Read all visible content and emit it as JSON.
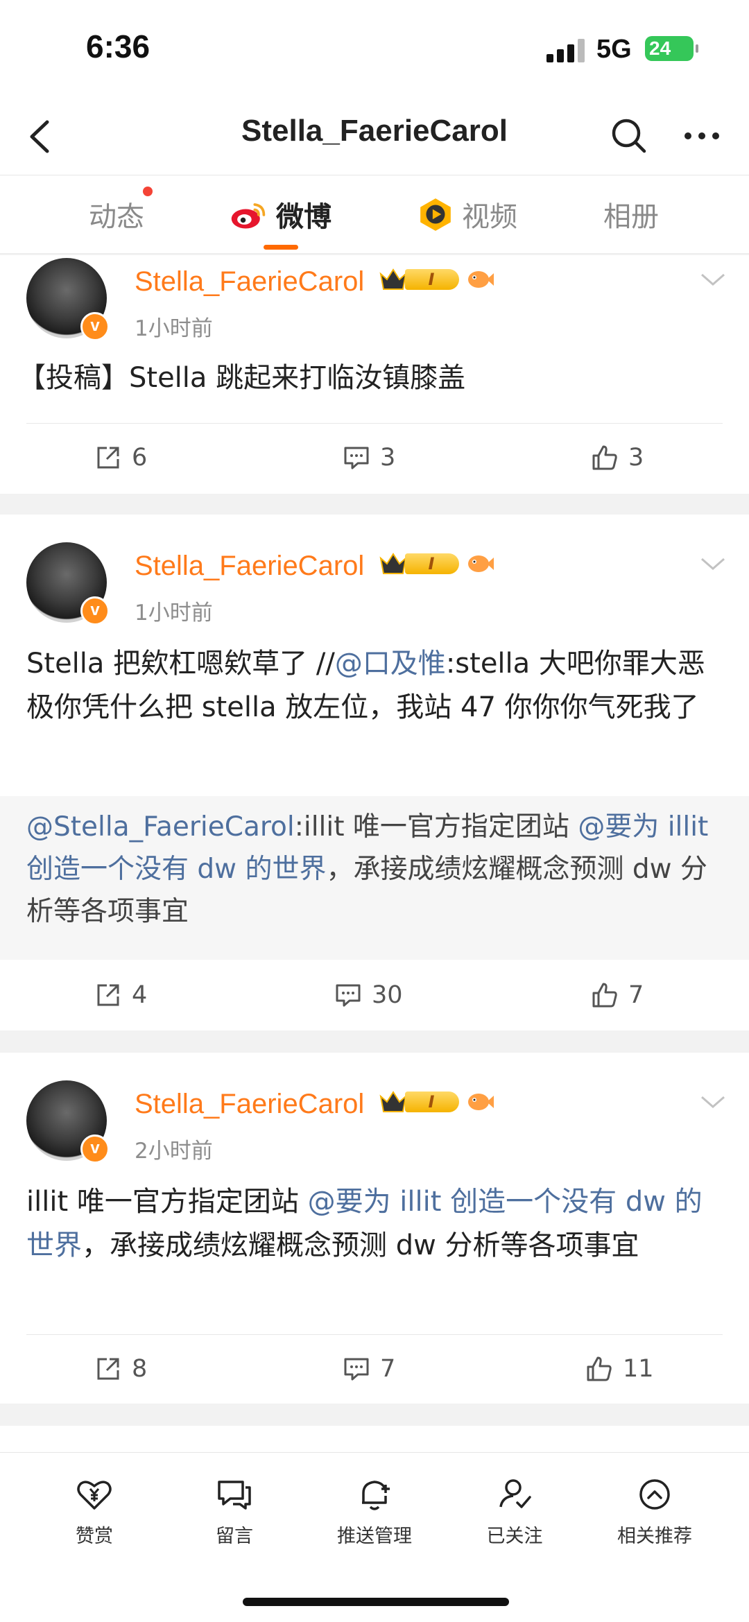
{
  "status_bar": {
    "time": "6:36",
    "network": "5G",
    "battery": "24"
  },
  "header": {
    "title": "Stella_FaerieCarol"
  },
  "tabs": [
    {
      "label": "动态",
      "has_dot": true
    },
    {
      "label": "微博",
      "active": true
    },
    {
      "label": "视频"
    },
    {
      "label": "相册"
    }
  ],
  "posts": [
    {
      "author": "Stella_FaerieCarol",
      "level": "I",
      "time": "1小时前",
      "text": "【投稿】Stella 跳起来打临汝镇膝盖",
      "repost_count": "6",
      "comment_count": "3",
      "like_count": "3"
    },
    {
      "author": "Stella_FaerieCarol",
      "level": "I",
      "time": "1小时前",
      "text_before": "Stella 把欸杠嗯欸草了 //",
      "mention": "@口及惟",
      "text_after": ":stella 大吧你罪大恶极你凭什么把 stella 放左位，我站 47 你你你气死我了",
      "repost_mention1": "@Stella_FaerieCarol",
      "repost_mid": ":illit 唯一官方指定团站 ",
      "repost_mention2": "@要为 illit 创造一个没有 dw 的世界",
      "repost_tail": "，承接成绩炫耀概念预测 dw 分析等各项事宜",
      "repost_count": "4",
      "comment_count": "30",
      "like_count": "7"
    },
    {
      "author": "Stella_FaerieCarol",
      "level": "I",
      "time": "2小时前",
      "text_before": "illit 唯一官方指定团站 ",
      "mention": "@要为 illit 创造一个没有 dw 的世界",
      "text_after": "，承接成绩炫耀概念预测 dw 分析等各项事宜",
      "repost_count": "8",
      "comment_count": "7",
      "like_count": "11"
    }
  ],
  "bottom_bar": [
    {
      "label": "赞赏",
      "icon": "heart-yen-icon"
    },
    {
      "label": "留言",
      "icon": "message-icon"
    },
    {
      "label": "推送管理",
      "icon": "bell-plus-icon"
    },
    {
      "label": "已关注",
      "icon": "user-check-icon"
    },
    {
      "label": "相关推荐",
      "icon": "chevron-up-circle-icon"
    }
  ],
  "colors": {
    "accent": "#ff7a1a",
    "mention": "#4e6f9e",
    "tab_underline": "#ff6a00"
  }
}
